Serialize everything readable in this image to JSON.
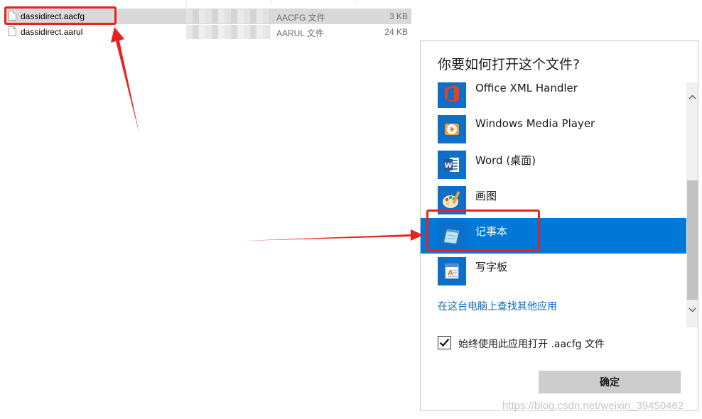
{
  "files": [
    {
      "name": "dassidirect.aacfg",
      "type": "AACFG 文件",
      "size": "3 KB",
      "selected": true
    },
    {
      "name": "dassidirect.aarul",
      "type": "AARUL 文件",
      "size": "24 KB",
      "selected": false
    }
  ],
  "dialog": {
    "title": "你要如何打开这个文件?",
    "apps": [
      {
        "label": "Office XML Handler",
        "icon": "office-icon"
      },
      {
        "label": "Windows Media Player",
        "icon": "media-player-icon"
      },
      {
        "label": "Word (桌面)",
        "icon": "word-icon"
      },
      {
        "label": "画图",
        "icon": "paint-icon"
      },
      {
        "label": "记事本",
        "icon": "notepad-icon",
        "selected": true
      },
      {
        "label": "写字板",
        "icon": "wordpad-icon"
      }
    ],
    "more_apps_link": "在这台电脑上查找其他应用",
    "always_use_label": "始终使用此应用打开 .aacfg 文件",
    "always_use_checked": true,
    "ok_label": "确定"
  },
  "watermark": "https://blog.csdn.net/weixin_39450462",
  "colors": {
    "accent": "#0078d7",
    "annotation": "#e8221d",
    "link": "#0067c0"
  }
}
